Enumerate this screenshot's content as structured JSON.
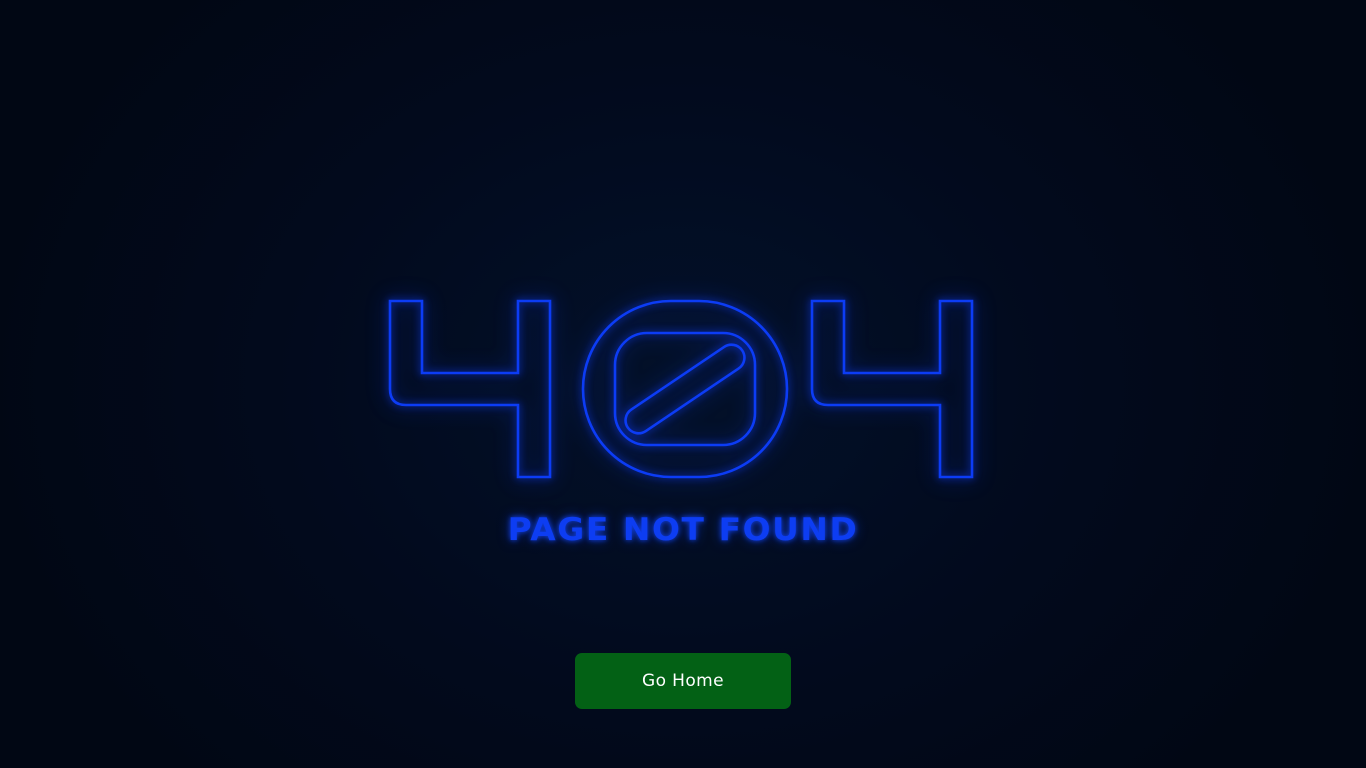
{
  "error": {
    "code": "404",
    "message": "PAGE NOT FOUND"
  },
  "actions": {
    "home_label": "Go Home"
  },
  "colors": {
    "neon": "#0c3cf5",
    "button": "#036115",
    "background": "#020a1d"
  }
}
